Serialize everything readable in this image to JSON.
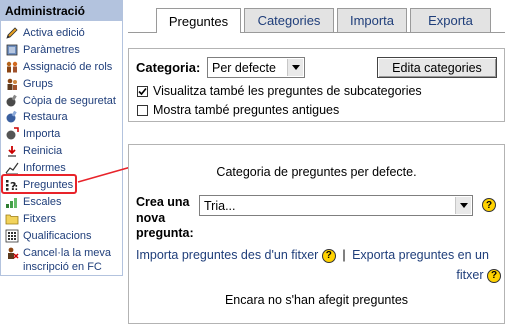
{
  "sidebar": {
    "title": "Administració",
    "items": [
      {
        "label": "Activa edició",
        "icon": "edit-icon"
      },
      {
        "label": "Paràmetres",
        "icon": "settings-icon"
      },
      {
        "label": "Assignació de rols",
        "icon": "roles-icon"
      },
      {
        "label": "Grups",
        "icon": "groups-icon"
      },
      {
        "label": "Còpia de seguretat",
        "icon": "backup-icon"
      },
      {
        "label": "Restaura",
        "icon": "restore-icon"
      },
      {
        "label": "Importa",
        "icon": "import-icon"
      },
      {
        "label": "Reinicia",
        "icon": "reset-icon"
      },
      {
        "label": "Informes",
        "icon": "reports-icon"
      },
      {
        "label": "Preguntes",
        "icon": "questions-icon"
      },
      {
        "label": "Escales",
        "icon": "scales-icon"
      },
      {
        "label": "Fitxers",
        "icon": "folder-icon"
      },
      {
        "label": "Qualificacions",
        "icon": "grades-icon"
      },
      {
        "label": "Cancel·la la meva inscripció en FC",
        "icon": "unenrol-icon"
      }
    ],
    "selected_index": 9
  },
  "tabs": [
    "Preguntes",
    "Categories",
    "Importa",
    "Exporta"
  ],
  "active_tab": 0,
  "top_panel": {
    "category_label": "Categoria:",
    "category_value": "Per defecte",
    "edit_button": "Edita categories",
    "checkbox1_label": "Visualitza també les preguntes de subcategories",
    "checkbox1_checked": true,
    "checkbox2_label": "Mostra també preguntes antigues",
    "checkbox2_checked": false
  },
  "bottom_panel": {
    "category_description": "Categoria de preguntes per defecte.",
    "create_label_line1": "Crea una",
    "create_label_line2": "nova",
    "create_label_line3": "pregunta:",
    "create_select_value": "Tria...",
    "import_link": "Importa preguntes des d'un fitxer",
    "separator": "|",
    "export_link_part1": "Exporta preguntes en un",
    "export_link_part2": "fitxer",
    "empty_message": "Encara no s'han afegit preguntes",
    "help_glyph": "?"
  },
  "colors": {
    "sidebar_header": "#b3c3de",
    "link": "#1f3e7a",
    "highlight": "#e8232a",
    "help_icon": "#ffd200"
  }
}
